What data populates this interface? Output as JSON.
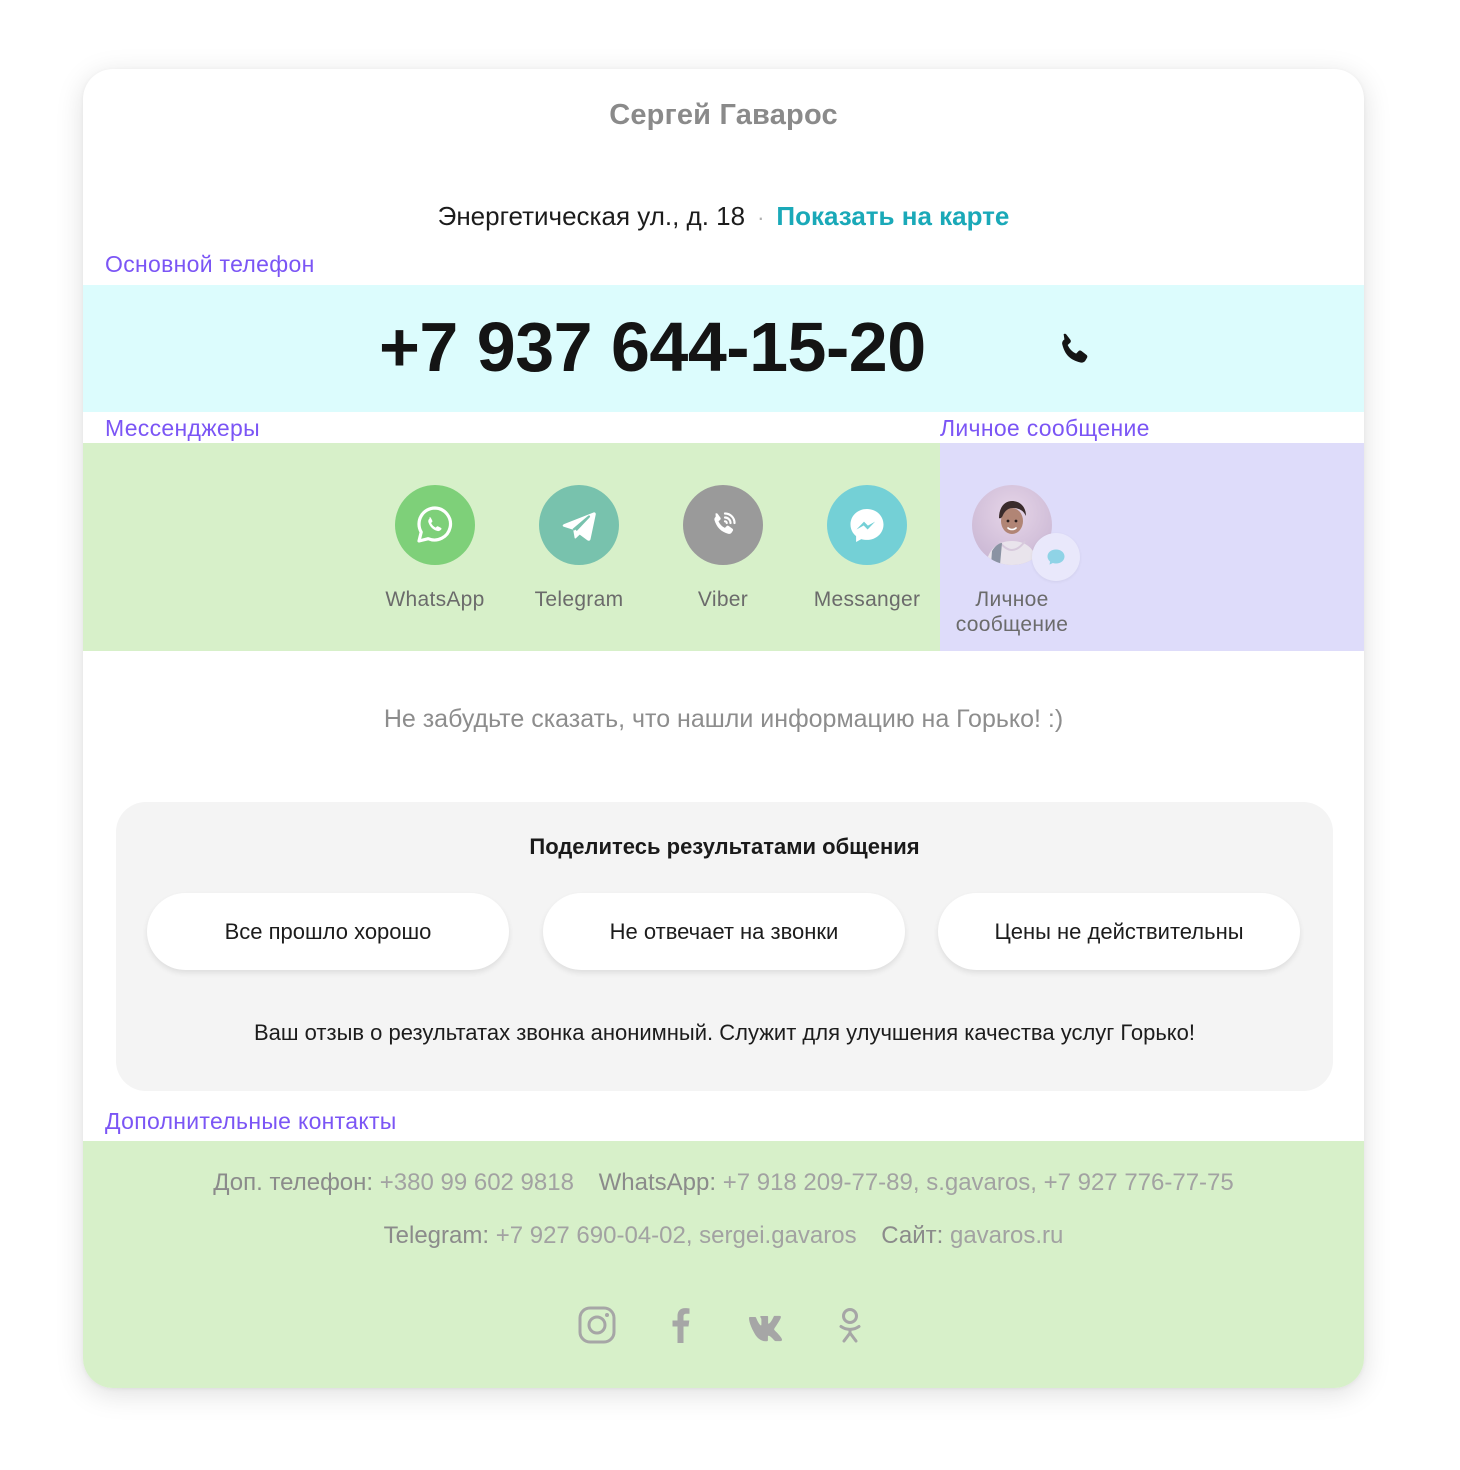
{
  "contact": {
    "name": "Сергей Гаварос",
    "address": "Энергетическая ул., д. 18",
    "address_separator": "·",
    "show_on_map": "Показать на карте"
  },
  "labels": {
    "main_phone": "Основной телефон",
    "messengers": "Мессенджеры",
    "personal_message": "Личное сообщение",
    "extra_contacts": "Дополнительные контакты"
  },
  "phone": {
    "number": "+7 937 644-15-20",
    "icon": "phone-icon"
  },
  "messengers": [
    {
      "label": "WhatsApp",
      "icon": "whatsapp-icon",
      "color": "#7ed079"
    },
    {
      "label": "Telegram",
      "icon": "telegram-icon",
      "color": "#78c2ad"
    },
    {
      "label": "Viber",
      "icon": "viber-icon",
      "color": "#9a9a9a"
    },
    {
      "label": "Messanger",
      "icon": "messenger-icon",
      "color": "#74d0d6"
    }
  ],
  "personal": {
    "label_line1": "Личное",
    "label_line2": "сообщение",
    "icon": "chat-icon"
  },
  "reminder": "Не забудьте сказать, что нашли информацию на Горько! :)",
  "feedback": {
    "title": "Поделитесь результатами общения",
    "buttons": [
      "Все прошло хорошо",
      "Не отвечает на звонки",
      "Цены не действительны"
    ],
    "note": "Ваш отзыв о результатах звонка анонимный. Служит для улучшения качества услуг Горько!"
  },
  "extra": {
    "line1": {
      "phone_label": "Доп. телефон:",
      "phone_value": "+380 99 602 9818",
      "whatsapp_label": "WhatsApp:",
      "whatsapp_value": "+7 918 209-77-89,",
      "skype_value": "s.gavaros,",
      "phone2_value": "+7 927 776-77-75"
    },
    "line2": {
      "telegram_label": "Telegram:",
      "telegram_value": "+7 927 690-04-02, sergei.gavaros",
      "site_label": "Сайт:",
      "site_value": "gavaros.ru"
    }
  },
  "socials": [
    "instagram-icon",
    "facebook-icon",
    "vk-icon",
    "odnoklassniki-icon"
  ],
  "colors": {
    "accent_label": "#7b55f5",
    "map_link": "#1aa9b8",
    "phone_band": "#dcfcfd",
    "messengers_band": "#d7f0c9",
    "personal_band": "#dedcfa",
    "extra_band": "#d7f0c9"
  }
}
